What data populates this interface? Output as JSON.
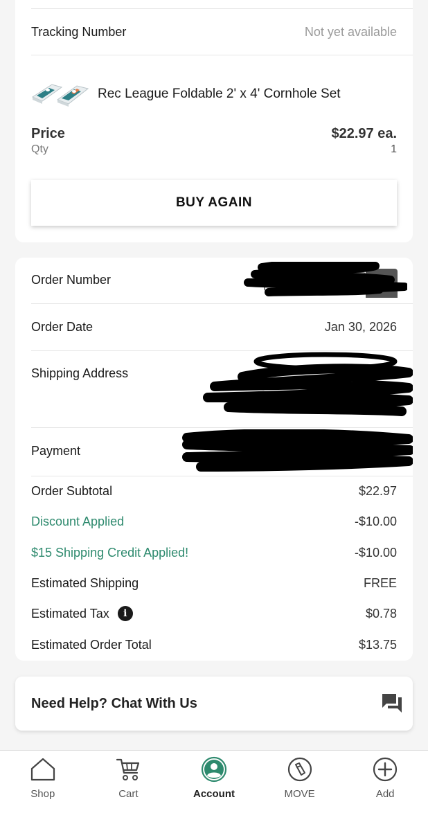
{
  "tracking": {
    "label": "Tracking Number",
    "value": "Not yet available"
  },
  "product": {
    "name": "Rec League Foldable 2' x 4' Cornhole Set",
    "thumbnail_icon": "cornhole-boards-thumbnail"
  },
  "pricing": {
    "price_label": "Price",
    "price_value": "$22.97 ea.",
    "qty_label": "Qty",
    "qty_value": "1"
  },
  "buy_again_label": "BUY AGAIN",
  "order": {
    "number_label": "Order Number",
    "date_label": "Order Date",
    "date_value": "Jan 30, 2026",
    "shipping_label": "Shipping Address",
    "payment_label": "Payment",
    "subtotal_label": "Order Subtotal",
    "subtotal_value": "$22.97",
    "discount_label": "Discount Applied",
    "discount_value": "-$10.00",
    "credit_label": "$15 Shipping Credit Applied!",
    "credit_value": "-$10.00",
    "shipping_est_label": "Estimated Shipping",
    "shipping_est_value": "FREE",
    "tax_label": "Estimated Tax",
    "tax_value": "$0.78",
    "total_label": "Estimated Order Total",
    "total_value": "$13.75"
  },
  "help": {
    "label": "Need Help? Chat With Us",
    "icon": "chat-icon"
  },
  "tabs": [
    {
      "label": "Shop",
      "icon": "home-icon"
    },
    {
      "label": "Cart",
      "icon": "cart-icon"
    },
    {
      "label": "Account",
      "icon": "account-icon",
      "active": true
    },
    {
      "label": "MOVE",
      "icon": "move-icon"
    },
    {
      "label": "Add",
      "icon": "plus-circle-icon"
    }
  ],
  "colors": {
    "accent_green": "#2e8a6e",
    "background": "#f5f5f5",
    "redaction": "#000000"
  }
}
